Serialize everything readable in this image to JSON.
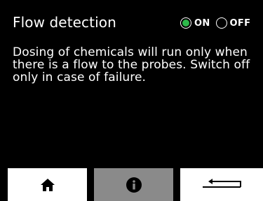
{
  "header": {
    "title": "Flow detection"
  },
  "toggle": {
    "on_label": "ON",
    "off_label": "OFF",
    "selected": "on",
    "selected_color": "#2db84a"
  },
  "content": {
    "description": "Dosing of chemicals will run only when there is a flow to the probes. Switch off only in case of failure."
  },
  "footer": {
    "buttons": [
      {
        "icon": "home-icon"
      },
      {
        "icon": "info-icon"
      },
      {
        "icon": "back-arrow-icon"
      }
    ]
  },
  "colors": {
    "background": "#000000",
    "text": "#ffffff",
    "button_light": "#ffffff",
    "button_active": "#8a8a8a",
    "accent": "#2db84a"
  }
}
